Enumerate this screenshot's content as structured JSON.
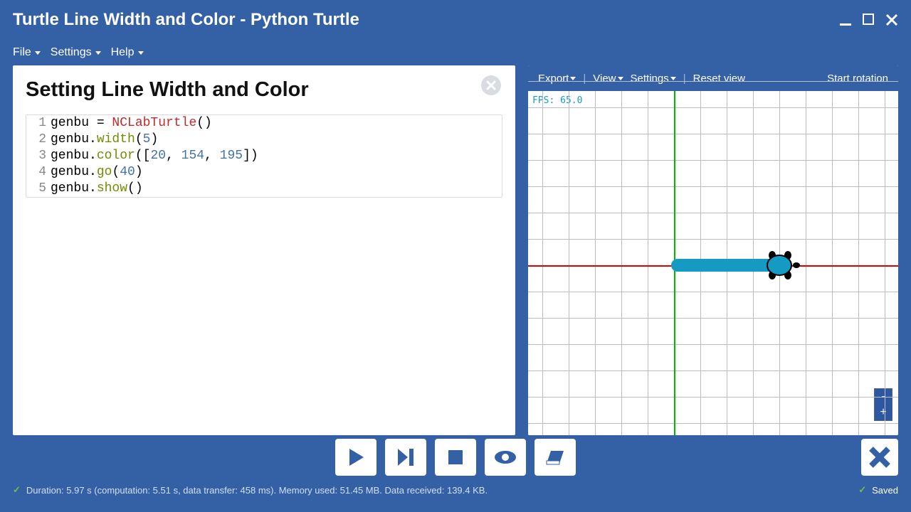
{
  "window": {
    "title": "Turtle Line Width and Color - Python Turtle"
  },
  "menu": {
    "file": "File",
    "settings": "Settings",
    "help": "Help"
  },
  "panel": {
    "heading": "Setting Line Width and Color",
    "code": [
      {
        "n": "1",
        "tokens": [
          [
            "var",
            "genbu"
          ],
          [
            "op",
            " = "
          ],
          [
            "class",
            "NCLabTurtle"
          ],
          [
            "op",
            "()"
          ]
        ]
      },
      {
        "n": "2",
        "tokens": [
          [
            "var",
            "genbu"
          ],
          [
            "op",
            "."
          ],
          [
            "method",
            "width"
          ],
          [
            "op",
            "("
          ],
          [
            "num",
            "5"
          ],
          [
            "op",
            ")"
          ]
        ]
      },
      {
        "n": "3",
        "tokens": [
          [
            "var",
            "genbu"
          ],
          [
            "op",
            "."
          ],
          [
            "method",
            "color"
          ],
          [
            "op",
            "(["
          ],
          [
            "num",
            "20"
          ],
          [
            "op",
            ", "
          ],
          [
            "num",
            "154"
          ],
          [
            "op",
            ", "
          ],
          [
            "num",
            "195"
          ],
          [
            "op",
            "])"
          ]
        ]
      },
      {
        "n": "4",
        "tokens": [
          [
            "var",
            "genbu"
          ],
          [
            "op",
            "."
          ],
          [
            "method",
            "go"
          ],
          [
            "op",
            "("
          ],
          [
            "num",
            "40"
          ],
          [
            "op",
            ")"
          ]
        ]
      },
      {
        "n": "5",
        "tokens": [
          [
            "var",
            "genbu"
          ],
          [
            "op",
            "."
          ],
          [
            "method",
            "show"
          ],
          [
            "op",
            "()"
          ]
        ]
      }
    ]
  },
  "right": {
    "toolbar": {
      "export": "Export",
      "view": "View",
      "settings": "Settings",
      "reset": "Reset view",
      "start_rotation": "Start rotation"
    },
    "fps_label": "FPS:",
    "fps_value": "65.0",
    "zoom": {
      "out": "-",
      "in": "+"
    }
  },
  "status": {
    "text": "Duration: 5.97 s (computation: 5.51 s, data transfer: 458 ms). Memory used: 51.45 MB. Data received: 139.4 KB.",
    "saved": "Saved"
  },
  "colors": {
    "brand": "#3460a5",
    "turtle_line": "#149ac3"
  }
}
